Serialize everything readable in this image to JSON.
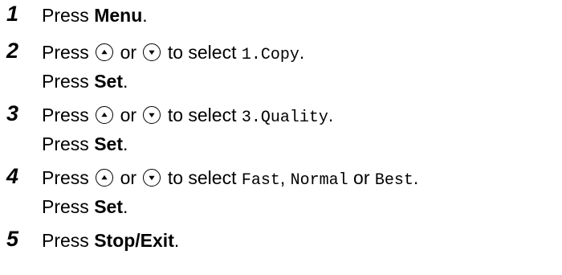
{
  "steps": [
    {
      "number": "1",
      "lines": [
        {
          "a": "Press ",
          "b": "Menu",
          "c": "."
        }
      ]
    },
    {
      "number": "2",
      "lines": [
        {
          "press": "Press",
          "or": "or",
          "to_select": "to select",
          "option": "1.Copy",
          "end": "."
        },
        {
          "a": "Press ",
          "b": "Set",
          "c": "."
        }
      ]
    },
    {
      "number": "3",
      "lines": [
        {
          "press": "Press",
          "or": "or",
          "to_select": "to select",
          "option": "3.Quality",
          "end": "."
        },
        {
          "a": "Press ",
          "b": "Set",
          "c": "."
        }
      ]
    },
    {
      "number": "4",
      "lines": [
        {
          "press": "Press",
          "or": "or",
          "to_select": "to select",
          "opt1": "Fast",
          "sep": ", ",
          "opt2": "Normal",
          "or2": " or ",
          "opt3": "Best",
          "end": "."
        },
        {
          "a": "Press ",
          "b": "Set",
          "c": "."
        }
      ]
    },
    {
      "number": "5",
      "lines": [
        {
          "a": "Press ",
          "b": "Stop/Exit",
          "c": "."
        }
      ]
    }
  ],
  "icons": {
    "up": "up-arrow-button-icon",
    "down": "down-arrow-button-icon"
  }
}
